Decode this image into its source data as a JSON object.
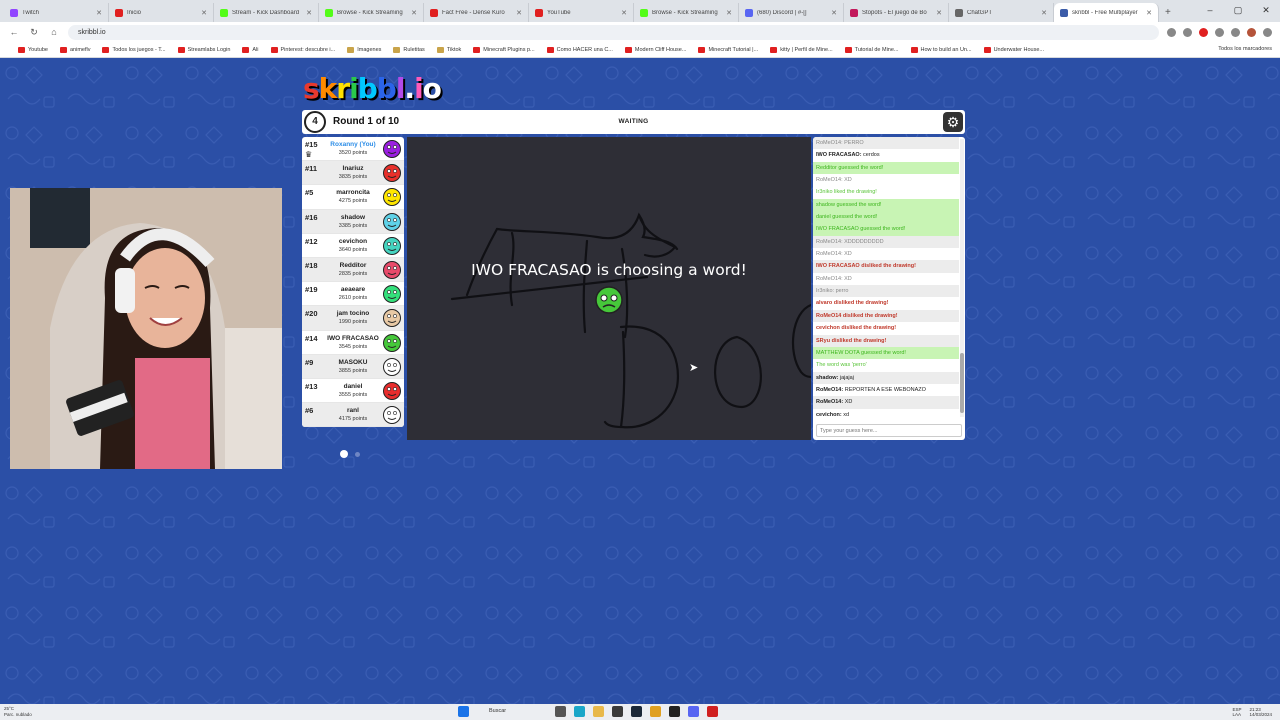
{
  "browser": {
    "tabs": [
      {
        "label": "Twitch",
        "color": "#9146ff",
        "active": false
      },
      {
        "label": "Inicio",
        "color": "#e02020",
        "active": false
      },
      {
        "label": "Stream - Kick Dashboard",
        "color": "#53fc18",
        "active": false
      },
      {
        "label": "Browse - Kick Streaming",
        "color": "#53fc18",
        "active": false
      },
      {
        "label": "Fact Free - Dense Kuro",
        "color": "#e02020",
        "active": false
      },
      {
        "label": "YouTube",
        "color": "#e02020",
        "active": false
      },
      {
        "label": "Browse - Kick Streaming",
        "color": "#53fc18",
        "active": false
      },
      {
        "label": "(680) Discord | #-[]",
        "color": "#5865f2",
        "active": false
      },
      {
        "label": "Stopots - El juego de Bo",
        "color": "#c2185b",
        "active": false
      },
      {
        "label": "ChatGPT",
        "color": "#666666",
        "active": false
      },
      {
        "label": "skribbl - Free Multiplayer",
        "color": "#3b5ca8",
        "active": true
      }
    ],
    "new_tab_symbol": "+",
    "window_controls": [
      "–",
      "▢",
      "✕"
    ],
    "address": "skribbl.io",
    "nav_icons": {
      "back": "←",
      "reload": "↻",
      "home": "⌂"
    },
    "bookmarks": [
      {
        "label": "Youtube",
        "type": "yt"
      },
      {
        "label": "animeflv",
        "type": "yt"
      },
      {
        "label": "Todos los juegos - T...",
        "type": "yt"
      },
      {
        "label": "Streamlabs Login",
        "type": "yt"
      },
      {
        "label": "Ali",
        "type": "yt"
      },
      {
        "label": "Pinterest: descubre i...",
        "type": "yt"
      },
      {
        "label": "Imagenes",
        "type": "folder"
      },
      {
        "label": "Ruletitas",
        "type": "folder"
      },
      {
        "label": "Tiktok",
        "type": "folder"
      },
      {
        "label": "Minecraft Plugins p...",
        "type": "yt"
      },
      {
        "label": "Como HACER una C...",
        "type": "yt"
      },
      {
        "label": "Modern Cliff House...",
        "type": "yt"
      },
      {
        "label": "Minecraft Tutorial |...",
        "type": "yt"
      },
      {
        "label": "kitty | Perfil de Mine...",
        "type": "yt"
      },
      {
        "label": "Tutorial de Mine...",
        "type": "yt"
      },
      {
        "label": "How to build an Un...",
        "type": "yt"
      },
      {
        "label": "Underwater House...",
        "type": "yt"
      }
    ],
    "bookmarks_right": "Todos los marcadores"
  },
  "game": {
    "logo_letters": [
      "s",
      "k",
      "r",
      "i",
      "b",
      "b",
      "l",
      ".",
      "i",
      "o"
    ],
    "logo_colors": [
      "#e8392e",
      "#ff8a00",
      "#ffe100",
      "#2ac94a",
      "#00c8ff",
      "#2b64e8",
      "#b24ae8",
      "#ffffff",
      "#ff5ab8",
      "#ffffff"
    ],
    "round_number": "4",
    "round_label": "Round 1 of 10",
    "status": "WAITING",
    "settings_icon": "⚙",
    "players": [
      {
        "rank": "#15",
        "name": "Roxanny (You)",
        "points": "3520 points",
        "you": true,
        "crown": true,
        "color": "#9b1fe0"
      },
      {
        "rank": "#11",
        "name": "Inariuz",
        "points": "3835 points",
        "color": "#e8302b"
      },
      {
        "rank": "#5",
        "name": "marroncita",
        "points": "4275 points",
        "color": "#ffe600"
      },
      {
        "rank": "#16",
        "name": "shadow",
        "points": "3385 points",
        "color": "#5fd2e8"
      },
      {
        "rank": "#12",
        "name": "cevichon",
        "points": "3640 points",
        "color": "#45d4c0"
      },
      {
        "rank": "#18",
        "name": "Redditor",
        "points": "2835 points",
        "color": "#e84a6a"
      },
      {
        "rank": "#19",
        "name": "aeaeare",
        "points": "2610 points",
        "color": "#34e07b"
      },
      {
        "rank": "#20",
        "name": "jam tocino",
        "points": "1990 points",
        "color": "#e8c9a5"
      },
      {
        "rank": "#14",
        "name": "IWO FRACASAO",
        "points": "3545 points",
        "color": "#46c83a"
      },
      {
        "rank": "#9",
        "name": "MASOKU",
        "points": "3855 points",
        "color": "#ffffff"
      },
      {
        "rank": "#13",
        "name": "daniel",
        "points": "3555 points",
        "color": "#e82d2d"
      },
      {
        "rank": "#6",
        "name": "ranl",
        "points": "4175 points",
        "color": "#ffffff"
      }
    ],
    "canvas_overlay": "IWO FRACASAO is choosing a word!",
    "chat": [
      {
        "text": "RoMeO14: PERRO",
        "style": "gray grey-t"
      },
      {
        "author": "IWO FRACASAO:",
        "text": " cerdos",
        "style": "white"
      },
      {
        "text": "Redditor guessed the word!",
        "style": "green"
      },
      {
        "text": "RoMeO14: XD",
        "style": "white grey-t"
      },
      {
        "text": "Ir3niko liked the drawing!",
        "style": "green-t"
      },
      {
        "text": "shadow guessed the word!",
        "style": "green"
      },
      {
        "text": "daniel guessed the word!",
        "style": "green"
      },
      {
        "text": "IWO FRACASAO guessed the word!",
        "style": "green"
      },
      {
        "text": "RoMeO14: XDDDDDDDDD",
        "style": "gray grey-t"
      },
      {
        "text": "RoMeO14: XD",
        "style": "white grey-t"
      },
      {
        "text": "IWO FRACASAO disliked the drawing!",
        "style": "red gray"
      },
      {
        "text": "RoMeO14: XD",
        "style": "white grey-t"
      },
      {
        "text": "Ir3niko: perro",
        "style": "gray grey-t"
      },
      {
        "text": "alvaro disliked the drawing!",
        "style": "red white"
      },
      {
        "text": "RoMeO14 disliked the drawing!",
        "style": "red gray"
      },
      {
        "text": "cevichon disliked the drawing!",
        "style": "red white"
      },
      {
        "text": "SRyu disliked the drawing!",
        "style": "red gray"
      },
      {
        "text": "MATTHEW DOTA guessed the word!",
        "style": "green"
      },
      {
        "text": "The word was 'perro'",
        "style": "green-t"
      },
      {
        "author": "shadow:",
        "text": " jajajaj",
        "style": "gray"
      },
      {
        "author": "RoMeO14:",
        "text": " REPORTEN A ESE WEBONAZO",
        "style": "white"
      },
      {
        "author": "RoMeO14:",
        "text": " XD",
        "style": "gray"
      },
      {
        "author": "cevichon:",
        "text": " xd",
        "style": "white"
      }
    ],
    "chat_placeholder": "Type your guess here..."
  },
  "taskbar": {
    "weather_temp": "25°C",
    "weather_desc": "Parc. nublado",
    "search_label": "Buscar",
    "lang": "ESP",
    "lang_sub": "LAA",
    "time": "21:23",
    "date": "14/03/2024"
  }
}
